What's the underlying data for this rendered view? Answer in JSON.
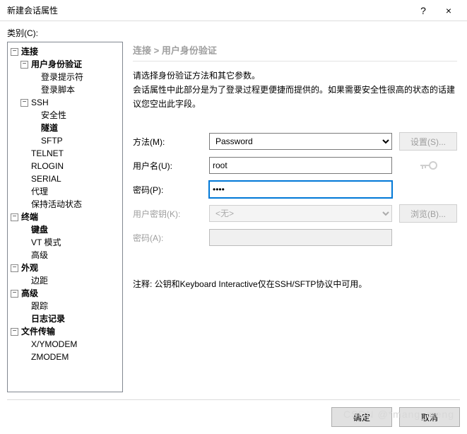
{
  "titlebar": {
    "title": "新建会话属性",
    "help": "?",
    "close": "×"
  },
  "category_label": "类别(C):",
  "tree": {
    "connection": "连接",
    "auth": "用户身份验证",
    "login_prompt": "登录提示符",
    "login_script": "登录脚本",
    "ssh": "SSH",
    "security": "安全性",
    "tunnel": "隧道",
    "sftp": "SFTP",
    "telnet": "TELNET",
    "rlogin": "RLOGIN",
    "serial": "SERIAL",
    "proxy": "代理",
    "keepalive": "保持活动状态",
    "terminal": "终端",
    "keyboard": "键盘",
    "vtmode": "VT 模式",
    "advanced_term": "高级",
    "appearance": "外观",
    "margin": "边距",
    "advanced": "高级",
    "trace": "跟踪",
    "logging": "日志记录",
    "filetransfer": "文件传输",
    "xymodem": "X/YMODEM",
    "zmodem": "ZMODEM"
  },
  "breadcrumb": "连接 > 用户身份验证",
  "desc_line1": "请选择身份验证方法和其它参数。",
  "desc_line2": "会话属性中此部分是为了登录过程更便捷而提供的。如果需要安全性很高的状态的话建议您空出此字段。",
  "form": {
    "method_label": "方法(M):",
    "method_value": "Password",
    "settings_btn": "设置(S)...",
    "username_label": "用户名(U):",
    "username_value": "root",
    "password_label": "密码(P):",
    "password_value": "••••",
    "userkey_label": "用户密钥(K):",
    "userkey_value": "<无>",
    "browse_btn": "浏览(B)...",
    "passphrase_label": "密码(A):"
  },
  "note": "注释: 公钥和Keyboard Interactive仅在SSH/SFTP协议中可用。",
  "footer": {
    "ok": "确定",
    "cancel": "取消"
  },
  "watermark": "CSDN @*mang_meng"
}
